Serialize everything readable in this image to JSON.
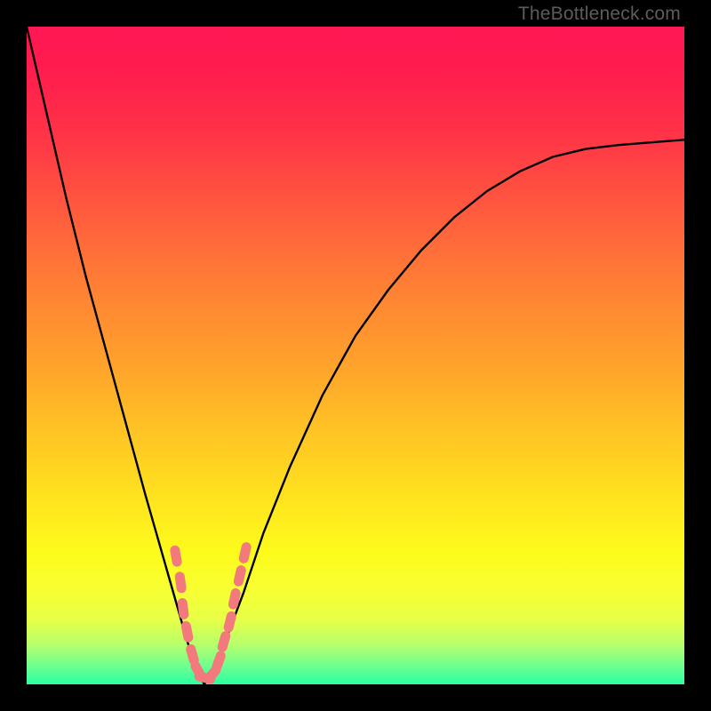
{
  "watermark": "TheBottleneck.com",
  "chart_data": {
    "type": "line",
    "title": "",
    "xlabel": "",
    "ylabel": "",
    "xlim": [
      0,
      100
    ],
    "ylim": [
      0,
      100
    ],
    "series": [
      {
        "name": "bottleneck-curve",
        "x": [
          0,
          3,
          6,
          9,
          12,
          15,
          18,
          20,
          22,
          24,
          25.5,
          27,
          28.5,
          30,
          33,
          36,
          40,
          45,
          50,
          55,
          60,
          65,
          70,
          75,
          80,
          85,
          90,
          95,
          100
        ],
        "y": [
          100,
          87,
          74,
          62,
          51,
          40,
          29,
          22,
          15,
          8,
          3,
          0,
          2,
          6,
          14,
          23,
          33,
          44,
          53,
          60,
          66,
          71,
          75,
          78,
          80.2,
          81.4,
          82,
          82.4,
          82.8
        ]
      }
    ],
    "markers": {
      "name": "highlighted-points",
      "color": "#f37a7c",
      "points": [
        {
          "x": 22.7,
          "y": 19.5
        },
        {
          "x": 23.4,
          "y": 15.5
        },
        {
          "x": 23.8,
          "y": 11.5
        },
        {
          "x": 24.4,
          "y": 8.0
        },
        {
          "x": 25.2,
          "y": 4.5
        },
        {
          "x": 26.1,
          "y": 2.0
        },
        {
          "x": 27.1,
          "y": 1.0
        },
        {
          "x": 28.2,
          "y": 1.5
        },
        {
          "x": 29.2,
          "y": 3.5
        },
        {
          "x": 30.0,
          "y": 6.5
        },
        {
          "x": 30.9,
          "y": 9.5
        },
        {
          "x": 31.6,
          "y": 13.0
        },
        {
          "x": 32.4,
          "y": 16.5
        },
        {
          "x": 33.2,
          "y": 20.0
        }
      ]
    },
    "gradient_stops": [
      {
        "pos": 0.0,
        "color": "#ff1754"
      },
      {
        "pos": 0.5,
        "color": "#ffa42b"
      },
      {
        "pos": 0.8,
        "color": "#fdfb1c"
      },
      {
        "pos": 1.0,
        "color": "#2bffa2"
      }
    ]
  }
}
